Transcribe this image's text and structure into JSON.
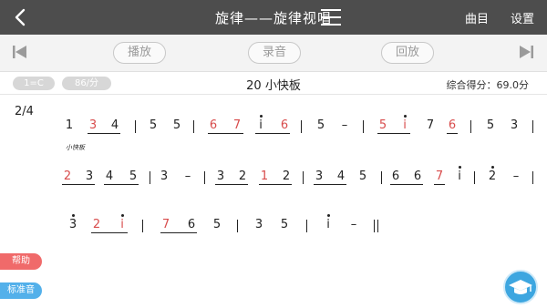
{
  "header": {
    "title": "旋律——旋律视唱",
    "links": {
      "catalog": "曲目",
      "settings": "设置"
    },
    "colors": {
      "bar": "#4d4d4d"
    }
  },
  "toolbar": {
    "play_label": "播放",
    "record_label": "录音",
    "playback_label": "回放"
  },
  "info": {
    "key_label": "1=C",
    "bpm_label": "86/分",
    "tempo_title": "20 小快板",
    "score_label": "综合得分：69.0分"
  },
  "sheet": {
    "meter": "2/4",
    "annotation": "小快板",
    "accent_color": "#d84c4c"
  },
  "side": {
    "help_label": "帮助",
    "standard_label": "标准音",
    "help_color": "#f06a6a",
    "standard_color": "#53b0ea"
  },
  "icons": {
    "back": "chevron-left-icon",
    "menu": "menu-icon",
    "prev": "skip-previous-icon",
    "next": "skip-next-icon",
    "fab": "graduation-cap-icon"
  }
}
